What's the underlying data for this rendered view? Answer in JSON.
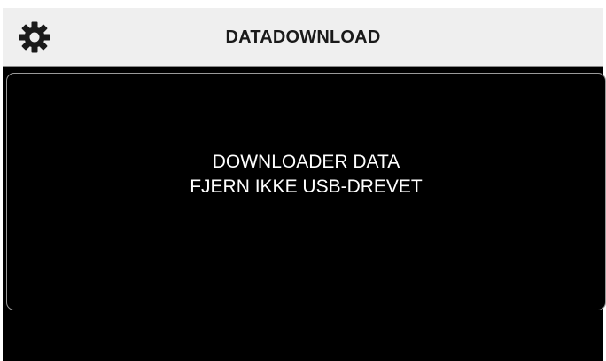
{
  "header": {
    "title": "DATADOWNLOAD",
    "settings_icon": "gear-icon"
  },
  "panel": {
    "line1": "DOWNLOADER DATA",
    "line2": "FJERN IKKE USB-DREVET"
  },
  "colors": {
    "header_bg": "#efefef",
    "screen_bg": "#000000",
    "text_light": "#ffffff",
    "text_dark": "#1a1a1a",
    "panel_border": "#9a9a9a"
  }
}
